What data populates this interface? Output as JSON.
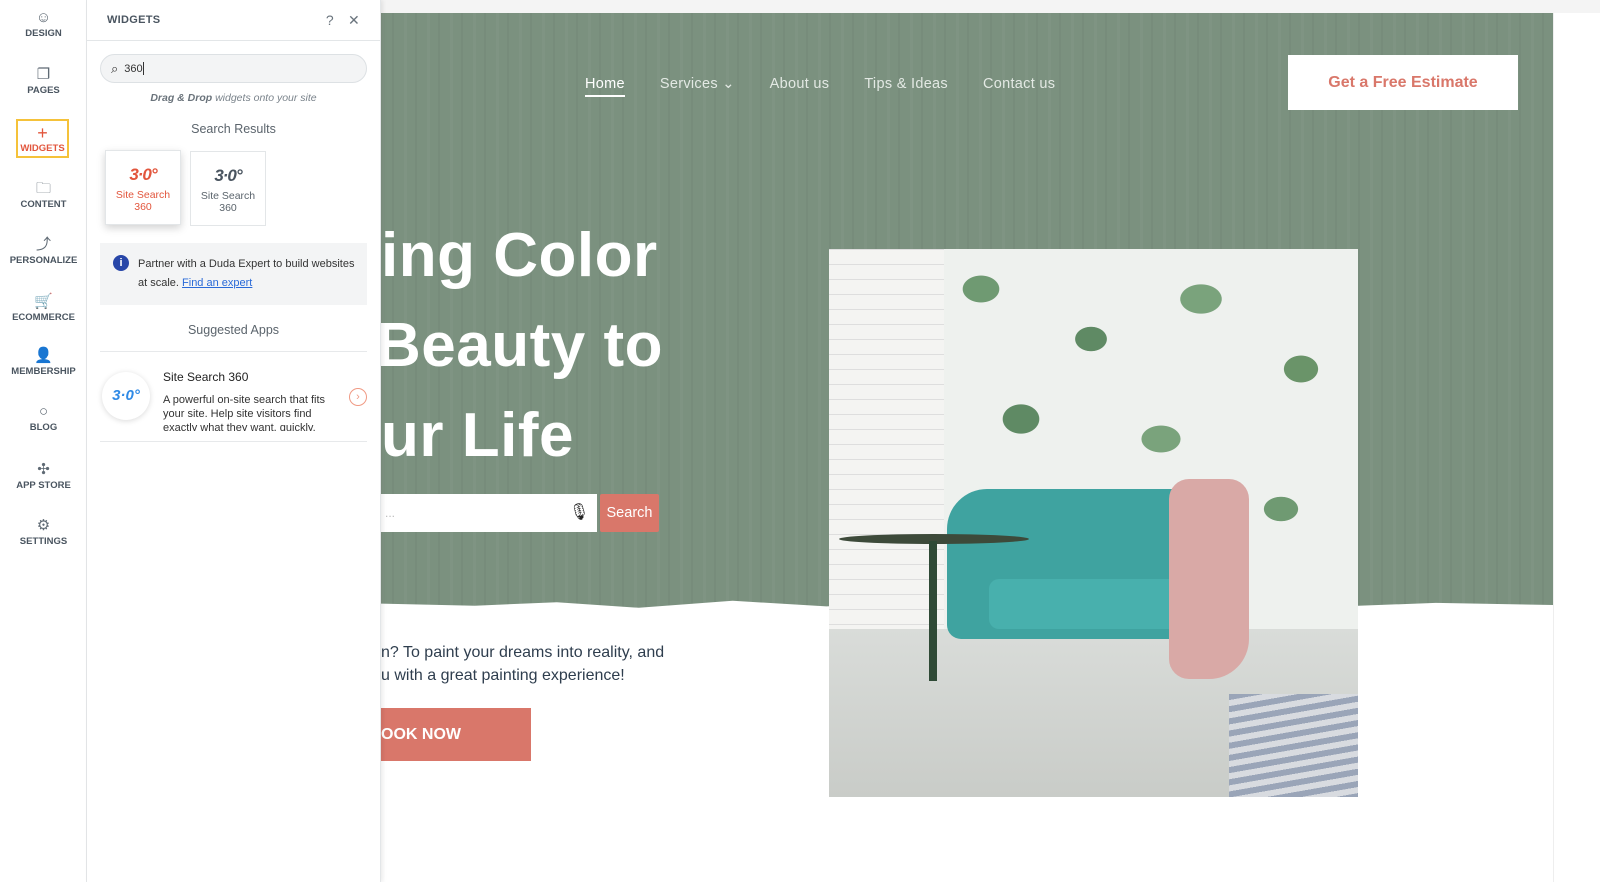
{
  "rail": [
    {
      "label": "DESIGN",
      "icon": "palette-icon",
      "glyph": "☺"
    },
    {
      "label": "PAGES",
      "icon": "pages-icon",
      "glyph": "❐"
    },
    {
      "label": "WIDGETS",
      "icon": "plus-icon",
      "glyph": "+"
    },
    {
      "label": "CONTENT",
      "icon": "folder-icon",
      "glyph": "🗀"
    },
    {
      "label": "PERSONALIZE",
      "icon": "personalize-icon",
      "glyph": "⤴"
    },
    {
      "label": "ECOMMERCE",
      "icon": "cart-icon",
      "glyph": "🛒"
    },
    {
      "label": "MEMBERSHIP",
      "icon": "person-icon",
      "glyph": "👤"
    },
    {
      "label": "BLOG",
      "icon": "chat-icon",
      "glyph": "○"
    },
    {
      "label": "APP STORE",
      "icon": "puzzle-icon",
      "glyph": "✣"
    },
    {
      "label": "SETTINGS",
      "icon": "gear-icon",
      "glyph": "⚙"
    }
  ],
  "panel": {
    "title": "WIDGETS",
    "help": "?",
    "close": "✕",
    "search_value": "360",
    "hint_bold": "Drag & Drop",
    "hint_rest": " widgets onto your site",
    "results_title": "Search Results",
    "results": [
      {
        "logo": "3·0°",
        "label": "Site Search 360"
      },
      {
        "logo": "3·0°",
        "label": "Site Search 360"
      }
    ],
    "info_text": "Partner with a Duda Expert to build websites at scale. ",
    "info_link": "Find an expert",
    "suggested_title": "Suggested Apps",
    "app": {
      "logo": "3·0°",
      "title": "Site Search 360",
      "desc": "A powerful on-site search that fits your site. Help site visitors find exactly what they want, quickly."
    }
  },
  "site": {
    "nav": [
      "Home",
      "Services ⌄",
      "About us",
      "Tips & Ideas",
      "Contact us"
    ],
    "cta": "Get a Free Estimate",
    "headline": [
      "ing Color",
      "Beauty to",
      "ur Life"
    ],
    "search_placeholder": "...",
    "search_button": "Search",
    "para": [
      "n? To paint your dreams into reality, and",
      "u with a great painting experience!"
    ],
    "book": "OOK NOW",
    "colors": {
      "hero": "#7b917f",
      "accent": "#d9776a"
    }
  }
}
